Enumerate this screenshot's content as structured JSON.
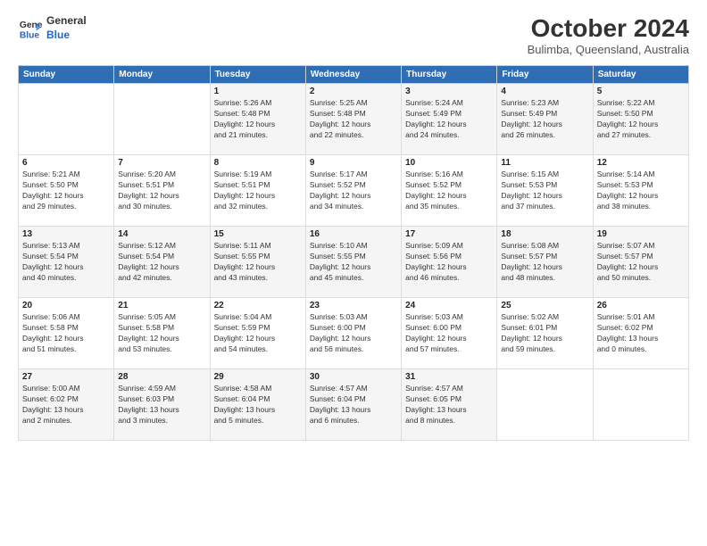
{
  "header": {
    "logo_line1": "General",
    "logo_line2": "Blue",
    "month": "October 2024",
    "location": "Bulimba, Queensland, Australia"
  },
  "days_of_week": [
    "Sunday",
    "Monday",
    "Tuesday",
    "Wednesday",
    "Thursday",
    "Friday",
    "Saturday"
  ],
  "weeks": [
    [
      {
        "day": "",
        "info": ""
      },
      {
        "day": "",
        "info": ""
      },
      {
        "day": "1",
        "info": "Sunrise: 5:26 AM\nSunset: 5:48 PM\nDaylight: 12 hours\nand 21 minutes."
      },
      {
        "day": "2",
        "info": "Sunrise: 5:25 AM\nSunset: 5:48 PM\nDaylight: 12 hours\nand 22 minutes."
      },
      {
        "day": "3",
        "info": "Sunrise: 5:24 AM\nSunset: 5:49 PM\nDaylight: 12 hours\nand 24 minutes."
      },
      {
        "day": "4",
        "info": "Sunrise: 5:23 AM\nSunset: 5:49 PM\nDaylight: 12 hours\nand 26 minutes."
      },
      {
        "day": "5",
        "info": "Sunrise: 5:22 AM\nSunset: 5:50 PM\nDaylight: 12 hours\nand 27 minutes."
      }
    ],
    [
      {
        "day": "6",
        "info": "Sunrise: 5:21 AM\nSunset: 5:50 PM\nDaylight: 12 hours\nand 29 minutes."
      },
      {
        "day": "7",
        "info": "Sunrise: 5:20 AM\nSunset: 5:51 PM\nDaylight: 12 hours\nand 30 minutes."
      },
      {
        "day": "8",
        "info": "Sunrise: 5:19 AM\nSunset: 5:51 PM\nDaylight: 12 hours\nand 32 minutes."
      },
      {
        "day": "9",
        "info": "Sunrise: 5:17 AM\nSunset: 5:52 PM\nDaylight: 12 hours\nand 34 minutes."
      },
      {
        "day": "10",
        "info": "Sunrise: 5:16 AM\nSunset: 5:52 PM\nDaylight: 12 hours\nand 35 minutes."
      },
      {
        "day": "11",
        "info": "Sunrise: 5:15 AM\nSunset: 5:53 PM\nDaylight: 12 hours\nand 37 minutes."
      },
      {
        "day": "12",
        "info": "Sunrise: 5:14 AM\nSunset: 5:53 PM\nDaylight: 12 hours\nand 38 minutes."
      }
    ],
    [
      {
        "day": "13",
        "info": "Sunrise: 5:13 AM\nSunset: 5:54 PM\nDaylight: 12 hours\nand 40 minutes."
      },
      {
        "day": "14",
        "info": "Sunrise: 5:12 AM\nSunset: 5:54 PM\nDaylight: 12 hours\nand 42 minutes."
      },
      {
        "day": "15",
        "info": "Sunrise: 5:11 AM\nSunset: 5:55 PM\nDaylight: 12 hours\nand 43 minutes."
      },
      {
        "day": "16",
        "info": "Sunrise: 5:10 AM\nSunset: 5:55 PM\nDaylight: 12 hours\nand 45 minutes."
      },
      {
        "day": "17",
        "info": "Sunrise: 5:09 AM\nSunset: 5:56 PM\nDaylight: 12 hours\nand 46 minutes."
      },
      {
        "day": "18",
        "info": "Sunrise: 5:08 AM\nSunset: 5:57 PM\nDaylight: 12 hours\nand 48 minutes."
      },
      {
        "day": "19",
        "info": "Sunrise: 5:07 AM\nSunset: 5:57 PM\nDaylight: 12 hours\nand 50 minutes."
      }
    ],
    [
      {
        "day": "20",
        "info": "Sunrise: 5:06 AM\nSunset: 5:58 PM\nDaylight: 12 hours\nand 51 minutes."
      },
      {
        "day": "21",
        "info": "Sunrise: 5:05 AM\nSunset: 5:58 PM\nDaylight: 12 hours\nand 53 minutes."
      },
      {
        "day": "22",
        "info": "Sunrise: 5:04 AM\nSunset: 5:59 PM\nDaylight: 12 hours\nand 54 minutes."
      },
      {
        "day": "23",
        "info": "Sunrise: 5:03 AM\nSunset: 6:00 PM\nDaylight: 12 hours\nand 56 minutes."
      },
      {
        "day": "24",
        "info": "Sunrise: 5:03 AM\nSunset: 6:00 PM\nDaylight: 12 hours\nand 57 minutes."
      },
      {
        "day": "25",
        "info": "Sunrise: 5:02 AM\nSunset: 6:01 PM\nDaylight: 12 hours\nand 59 minutes."
      },
      {
        "day": "26",
        "info": "Sunrise: 5:01 AM\nSunset: 6:02 PM\nDaylight: 13 hours\nand 0 minutes."
      }
    ],
    [
      {
        "day": "27",
        "info": "Sunrise: 5:00 AM\nSunset: 6:02 PM\nDaylight: 13 hours\nand 2 minutes."
      },
      {
        "day": "28",
        "info": "Sunrise: 4:59 AM\nSunset: 6:03 PM\nDaylight: 13 hours\nand 3 minutes."
      },
      {
        "day": "29",
        "info": "Sunrise: 4:58 AM\nSunset: 6:04 PM\nDaylight: 13 hours\nand 5 minutes."
      },
      {
        "day": "30",
        "info": "Sunrise: 4:57 AM\nSunset: 6:04 PM\nDaylight: 13 hours\nand 6 minutes."
      },
      {
        "day": "31",
        "info": "Sunrise: 4:57 AM\nSunset: 6:05 PM\nDaylight: 13 hours\nand 8 minutes."
      },
      {
        "day": "",
        "info": ""
      },
      {
        "day": "",
        "info": ""
      }
    ]
  ]
}
